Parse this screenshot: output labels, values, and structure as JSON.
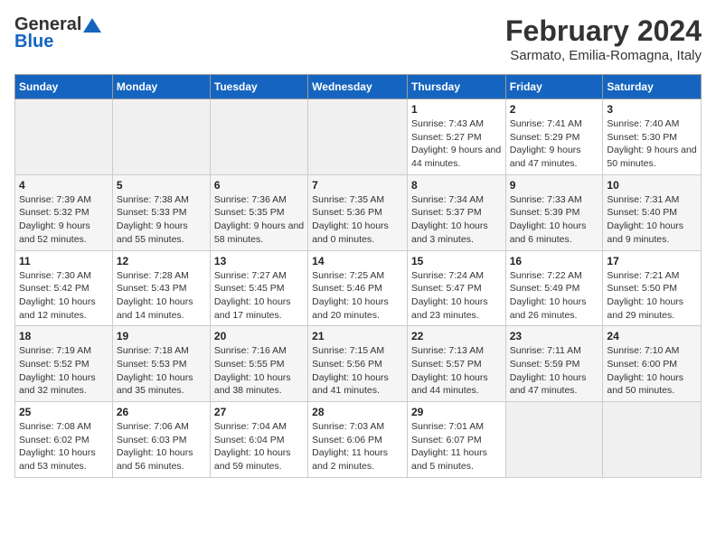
{
  "header": {
    "logo_general": "General",
    "logo_blue": "Blue",
    "main_title": "February 2024",
    "sub_title": "Sarmato, Emilia-Romagna, Italy"
  },
  "days_of_week": [
    "Sunday",
    "Monday",
    "Tuesday",
    "Wednesday",
    "Thursday",
    "Friday",
    "Saturday"
  ],
  "weeks": [
    [
      {
        "day": "",
        "info": ""
      },
      {
        "day": "",
        "info": ""
      },
      {
        "day": "",
        "info": ""
      },
      {
        "day": "",
        "info": ""
      },
      {
        "day": "1",
        "info": "Sunrise: 7:43 AM\nSunset: 5:27 PM\nDaylight: 9 hours and 44 minutes."
      },
      {
        "day": "2",
        "info": "Sunrise: 7:41 AM\nSunset: 5:29 PM\nDaylight: 9 hours and 47 minutes."
      },
      {
        "day": "3",
        "info": "Sunrise: 7:40 AM\nSunset: 5:30 PM\nDaylight: 9 hours and 50 minutes."
      }
    ],
    [
      {
        "day": "4",
        "info": "Sunrise: 7:39 AM\nSunset: 5:32 PM\nDaylight: 9 hours and 52 minutes."
      },
      {
        "day": "5",
        "info": "Sunrise: 7:38 AM\nSunset: 5:33 PM\nDaylight: 9 hours and 55 minutes."
      },
      {
        "day": "6",
        "info": "Sunrise: 7:36 AM\nSunset: 5:35 PM\nDaylight: 9 hours and 58 minutes."
      },
      {
        "day": "7",
        "info": "Sunrise: 7:35 AM\nSunset: 5:36 PM\nDaylight: 10 hours and 0 minutes."
      },
      {
        "day": "8",
        "info": "Sunrise: 7:34 AM\nSunset: 5:37 PM\nDaylight: 10 hours and 3 minutes."
      },
      {
        "day": "9",
        "info": "Sunrise: 7:33 AM\nSunset: 5:39 PM\nDaylight: 10 hours and 6 minutes."
      },
      {
        "day": "10",
        "info": "Sunrise: 7:31 AM\nSunset: 5:40 PM\nDaylight: 10 hours and 9 minutes."
      }
    ],
    [
      {
        "day": "11",
        "info": "Sunrise: 7:30 AM\nSunset: 5:42 PM\nDaylight: 10 hours and 12 minutes."
      },
      {
        "day": "12",
        "info": "Sunrise: 7:28 AM\nSunset: 5:43 PM\nDaylight: 10 hours and 14 minutes."
      },
      {
        "day": "13",
        "info": "Sunrise: 7:27 AM\nSunset: 5:45 PM\nDaylight: 10 hours and 17 minutes."
      },
      {
        "day": "14",
        "info": "Sunrise: 7:25 AM\nSunset: 5:46 PM\nDaylight: 10 hours and 20 minutes."
      },
      {
        "day": "15",
        "info": "Sunrise: 7:24 AM\nSunset: 5:47 PM\nDaylight: 10 hours and 23 minutes."
      },
      {
        "day": "16",
        "info": "Sunrise: 7:22 AM\nSunset: 5:49 PM\nDaylight: 10 hours and 26 minutes."
      },
      {
        "day": "17",
        "info": "Sunrise: 7:21 AM\nSunset: 5:50 PM\nDaylight: 10 hours and 29 minutes."
      }
    ],
    [
      {
        "day": "18",
        "info": "Sunrise: 7:19 AM\nSunset: 5:52 PM\nDaylight: 10 hours and 32 minutes."
      },
      {
        "day": "19",
        "info": "Sunrise: 7:18 AM\nSunset: 5:53 PM\nDaylight: 10 hours and 35 minutes."
      },
      {
        "day": "20",
        "info": "Sunrise: 7:16 AM\nSunset: 5:55 PM\nDaylight: 10 hours and 38 minutes."
      },
      {
        "day": "21",
        "info": "Sunrise: 7:15 AM\nSunset: 5:56 PM\nDaylight: 10 hours and 41 minutes."
      },
      {
        "day": "22",
        "info": "Sunrise: 7:13 AM\nSunset: 5:57 PM\nDaylight: 10 hours and 44 minutes."
      },
      {
        "day": "23",
        "info": "Sunrise: 7:11 AM\nSunset: 5:59 PM\nDaylight: 10 hours and 47 minutes."
      },
      {
        "day": "24",
        "info": "Sunrise: 7:10 AM\nSunset: 6:00 PM\nDaylight: 10 hours and 50 minutes."
      }
    ],
    [
      {
        "day": "25",
        "info": "Sunrise: 7:08 AM\nSunset: 6:02 PM\nDaylight: 10 hours and 53 minutes."
      },
      {
        "day": "26",
        "info": "Sunrise: 7:06 AM\nSunset: 6:03 PM\nDaylight: 10 hours and 56 minutes."
      },
      {
        "day": "27",
        "info": "Sunrise: 7:04 AM\nSunset: 6:04 PM\nDaylight: 10 hours and 59 minutes."
      },
      {
        "day": "28",
        "info": "Sunrise: 7:03 AM\nSunset: 6:06 PM\nDaylight: 11 hours and 2 minutes."
      },
      {
        "day": "29",
        "info": "Sunrise: 7:01 AM\nSunset: 6:07 PM\nDaylight: 11 hours and 5 minutes."
      },
      {
        "day": "",
        "info": ""
      },
      {
        "day": "",
        "info": ""
      }
    ]
  ]
}
